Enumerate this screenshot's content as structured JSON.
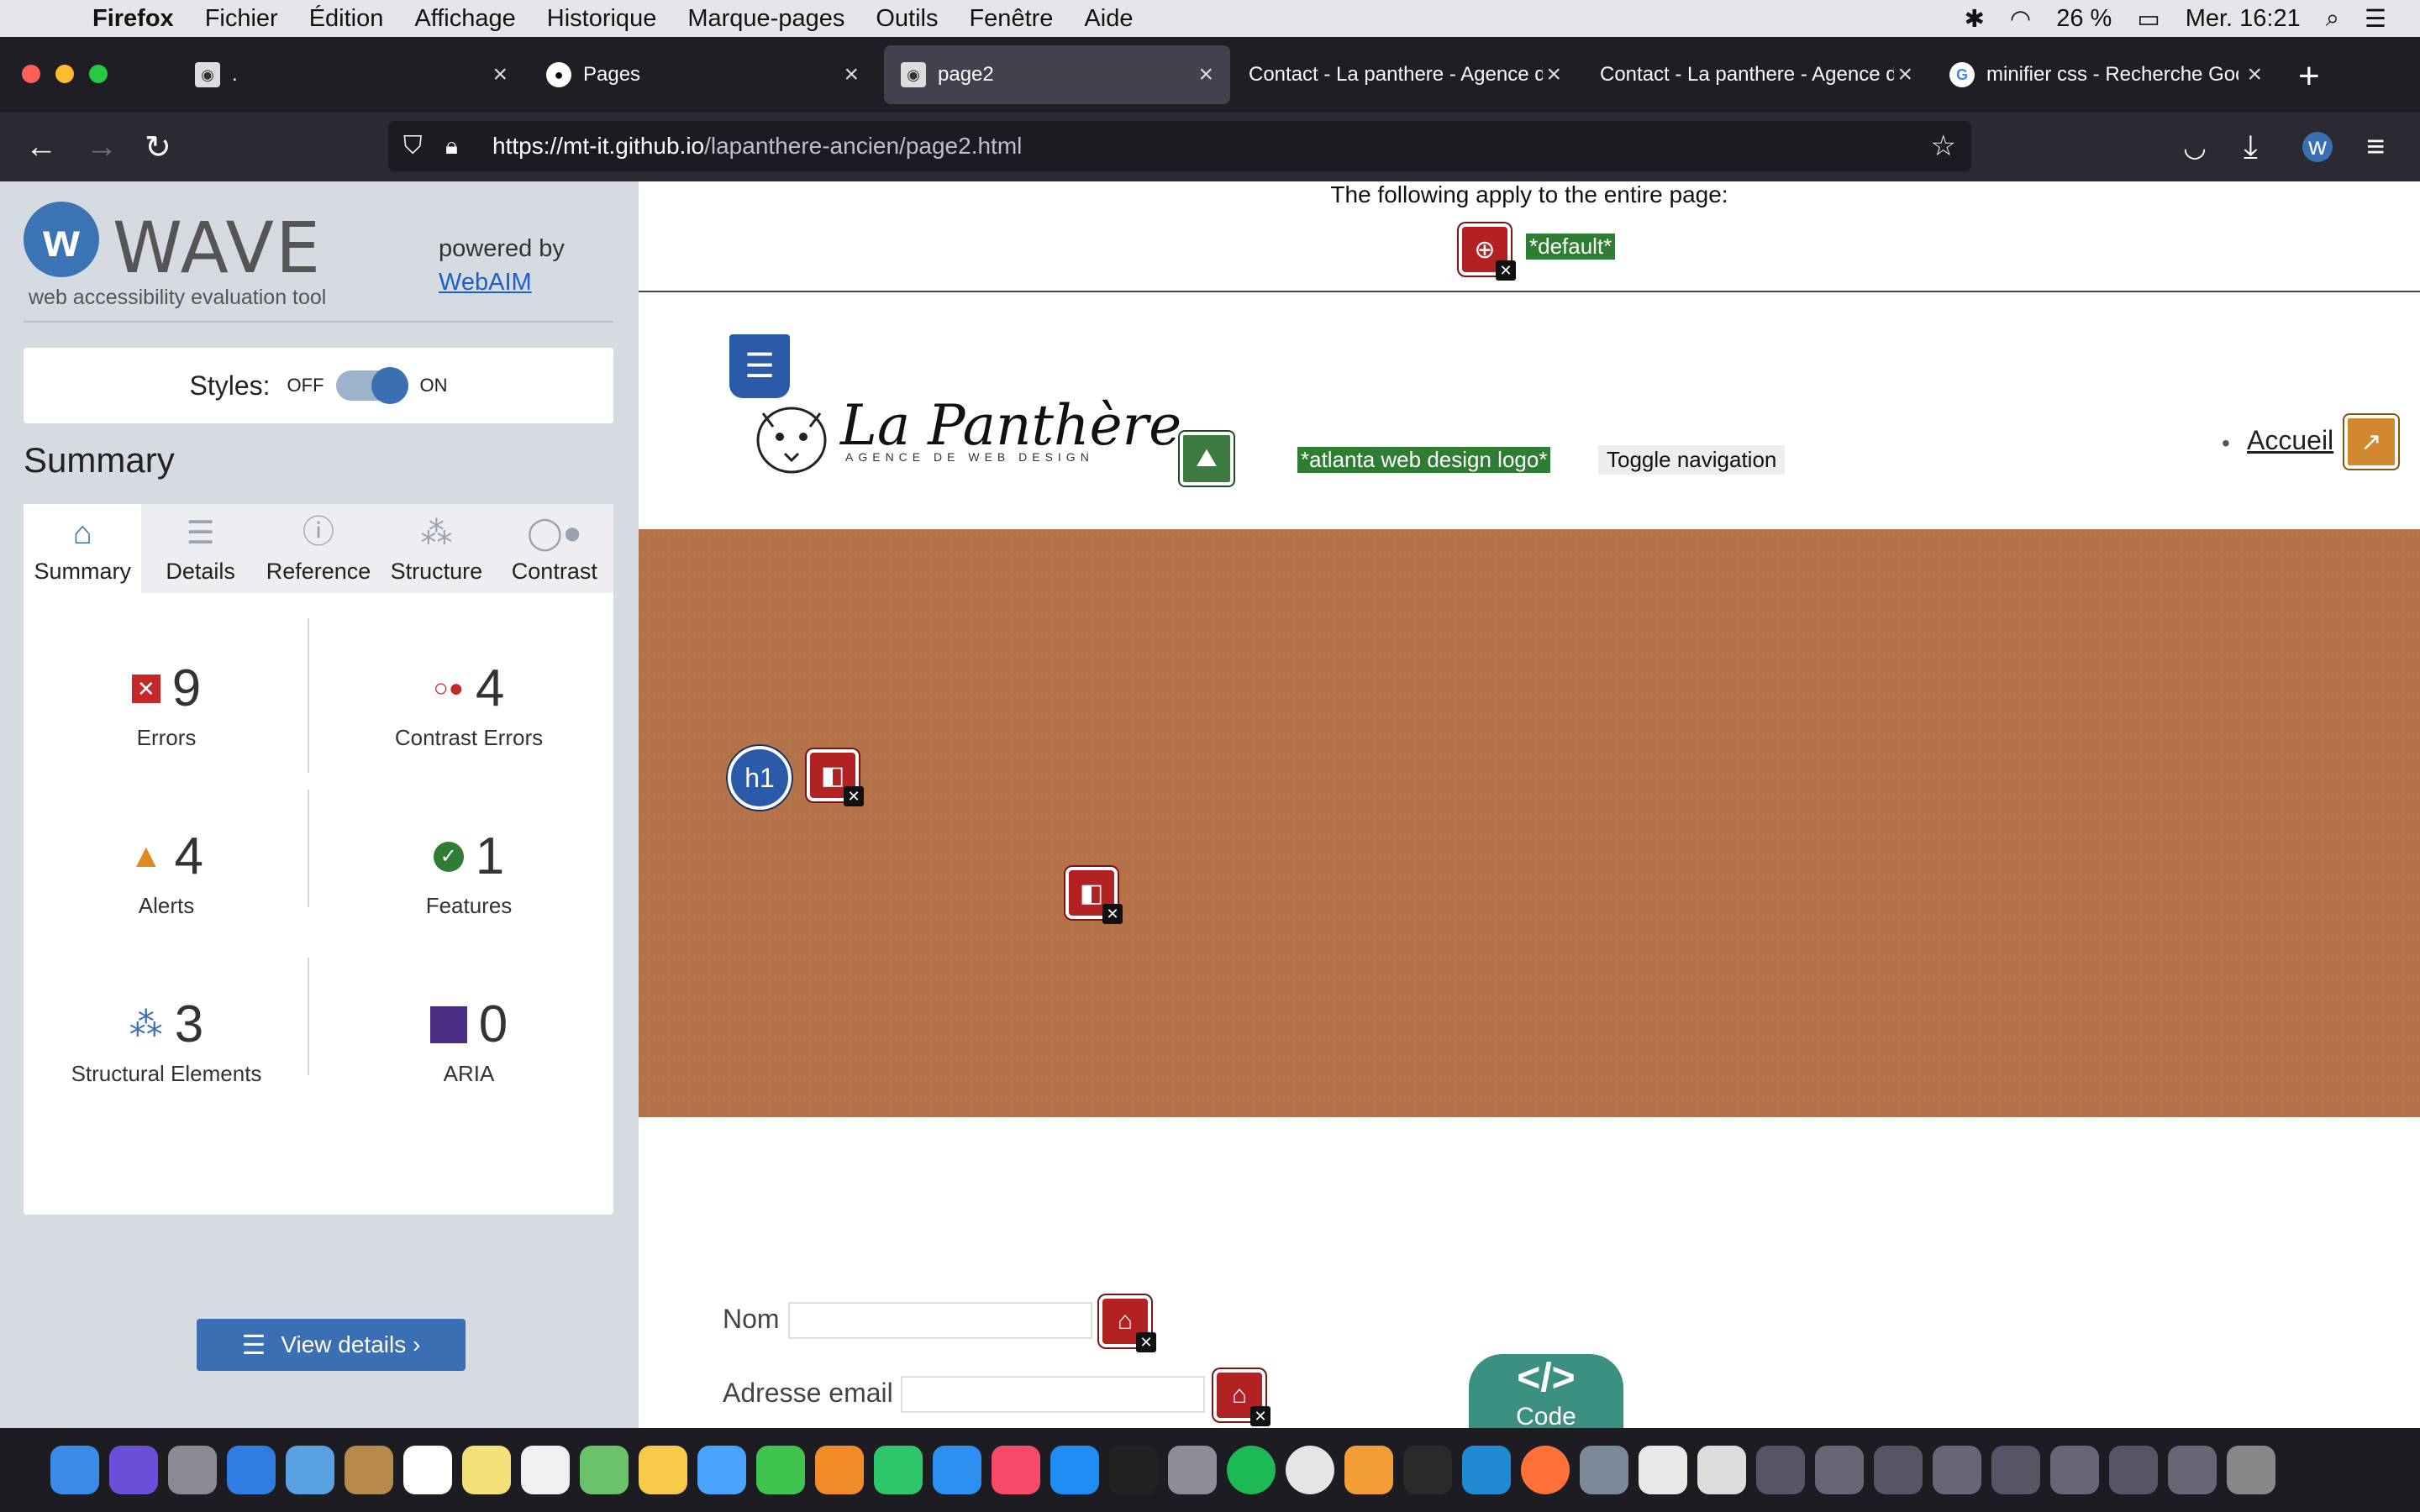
{
  "menubar": {
    "app": "Firefox",
    "items": [
      "Fichier",
      "Édition",
      "Affichage",
      "Historique",
      "Marque-pages",
      "Outils",
      "Fenêtre",
      "Aide"
    ],
    "battery": "26 %",
    "clock": "Mer. 16:21"
  },
  "tabs": [
    {
      "title": "."
    },
    {
      "title": "Pages"
    },
    {
      "title": "page2"
    },
    {
      "title": "Contact - La panthere - Agence de"
    },
    {
      "title": "Contact - La panthere - Agence de"
    },
    {
      "title": "minifier css - Recherche Google"
    }
  ],
  "url": {
    "host": "https://mt-it.github.io",
    "path": "/lapanthere-ancien/page2.html"
  },
  "wave": {
    "title": "WAVE",
    "subtitle": "web accessibility evaluation tool",
    "powered_by": "powered by",
    "webaim": "WebAIM",
    "styles_label": "Styles:",
    "off": "OFF",
    "on": "ON",
    "summary_heading": "Summary",
    "tabs": [
      "Summary",
      "Details",
      "Reference",
      "Structure",
      "Contrast"
    ],
    "stats": {
      "errors": {
        "value": "9",
        "label": "Errors"
      },
      "contrast": {
        "value": "4",
        "label": "Contrast Errors"
      },
      "alerts": {
        "value": "4",
        "label": "Alerts"
      },
      "features": {
        "value": "1",
        "label": "Features"
      },
      "structural": {
        "value": "3",
        "label": "Structural Elements"
      },
      "aria": {
        "value": "0",
        "label": "ARIA"
      }
    },
    "view_details": "View details ›"
  },
  "page": {
    "apply_text": "The following apply to the entire page:",
    "default_label": "*default*",
    "logo_text": "La Panthère",
    "logo_sub": "AGENCE DE WEB DESIGN",
    "logo_alt_label": "*atlanta web design logo*",
    "toggle_nav": "Toggle navigation",
    "nav_home": "Accueil",
    "h1_badge": "h1",
    "form_name": "Nom",
    "form_email": "Adresse email",
    "code_badge": "Code"
  },
  "colors": {
    "wave_blue": "#3b6fb4",
    "error_red": "#b22222",
    "brown_bg": "#b57349",
    "code_teal": "#3b9082"
  }
}
